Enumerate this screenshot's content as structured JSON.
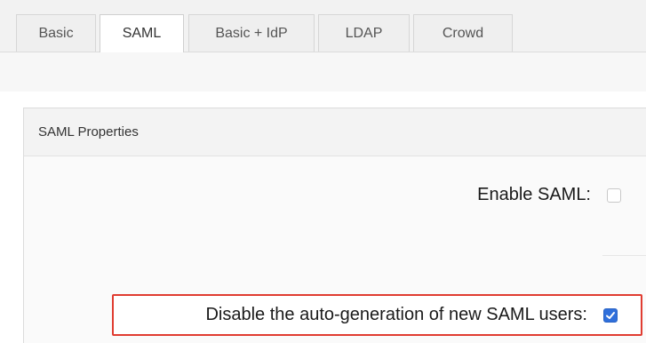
{
  "tabs": [
    {
      "label": "Basic",
      "active": false
    },
    {
      "label": "SAML",
      "active": true
    },
    {
      "label": "Basic + IdP",
      "active": false
    },
    {
      "label": "LDAP",
      "active": false
    },
    {
      "label": "Crowd",
      "active": false
    }
  ],
  "panel": {
    "title": "SAML Properties"
  },
  "fields": {
    "enable_saml": {
      "label": "Enable SAML:",
      "checked": false
    },
    "disable_autogen": {
      "label": "Disable the auto-generation of new SAML users:",
      "checked": true
    }
  },
  "colors": {
    "highlight_border": "#e03c31",
    "checkbox_checked": "#2f6fdb"
  }
}
